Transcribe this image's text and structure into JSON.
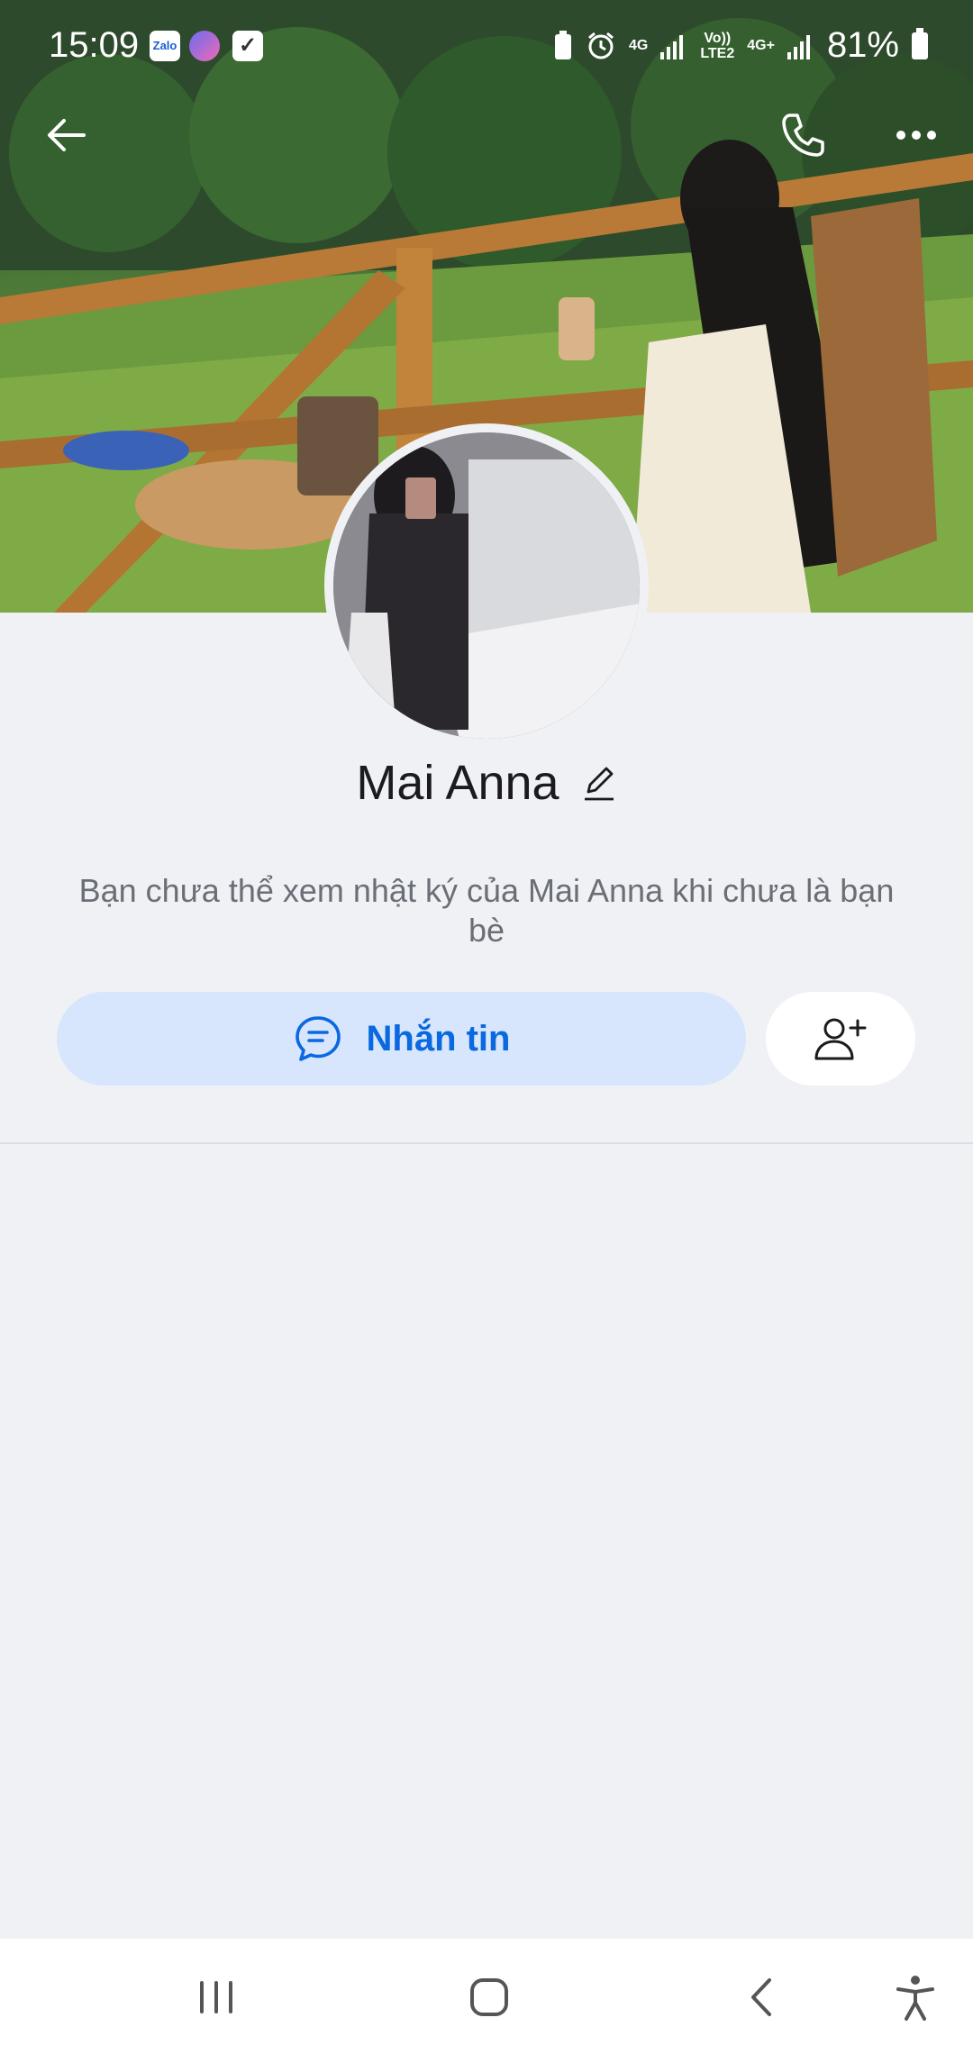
{
  "status_bar": {
    "time": "15:09",
    "app_icons": [
      "zalo-icon",
      "messenger-icon",
      "checkbox-icon"
    ],
    "zalo_label": "Zalo",
    "network_1": "4G",
    "network_2_top": "Vo))",
    "network_2_bottom": "LTE2",
    "network_3": "4G+",
    "battery": "81%"
  },
  "profile": {
    "name": "Mai Anna",
    "notice": "Bạn chưa thể xem nhật ký của Mai Anna khi chưa là bạn bè"
  },
  "actions": {
    "message_label": "Nhắn tin"
  },
  "colors": {
    "accent": "#0a68e0",
    "accent_bg": "#d7e6fc",
    "page_bg": "#f0f1f5"
  }
}
